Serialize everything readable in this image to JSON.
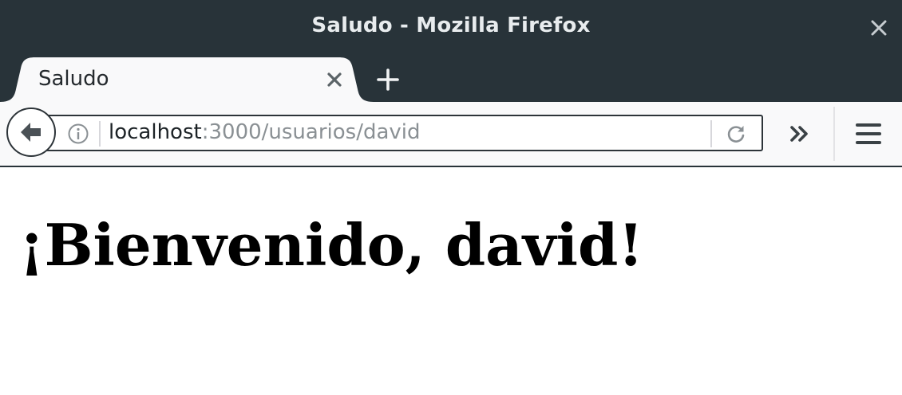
{
  "window": {
    "title": "Saludo - Mozilla Firefox"
  },
  "tabs": [
    {
      "label": "Saludo",
      "active": true
    }
  ],
  "navbar": {
    "url_host": "localhost",
    "url_path": ":3000/usuarios/david"
  },
  "page": {
    "heading": "¡Bienvenido, david!"
  },
  "icons": {
    "close": "close-icon",
    "tab_close": "close-icon",
    "new_tab": "plus-icon",
    "back": "back-arrow-icon",
    "info": "info-icon",
    "reload": "reload-icon",
    "overflow": "double-chevron-icon",
    "menu": "hamburger-icon"
  },
  "colors": {
    "titlebar": "#283339",
    "tab_active": "#f9f9fa",
    "content_bg": "#ffffff"
  }
}
